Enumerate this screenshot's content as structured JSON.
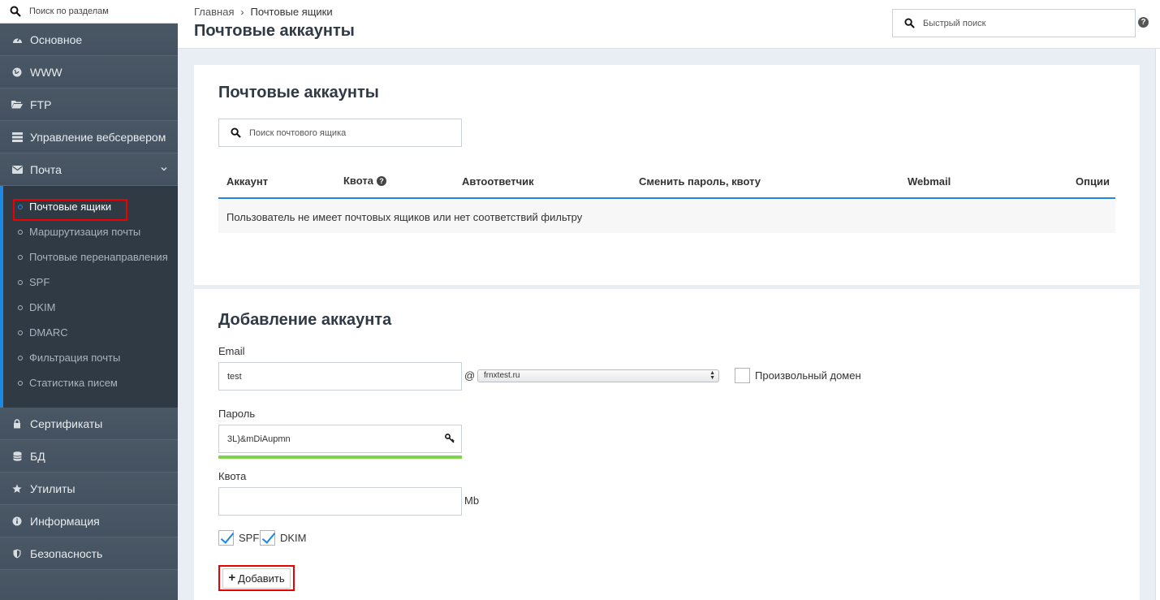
{
  "sidebar": {
    "search_placeholder": "Поиск по разделам",
    "items_top": [
      {
        "label": "Основное",
        "icon": "dashboard-icon"
      },
      {
        "label": "WWW",
        "icon": "globe-icon"
      },
      {
        "label": "FTP",
        "icon": "folder-icon"
      },
      {
        "label": "Управление вебсервером",
        "icon": "server-icon"
      },
      {
        "label": "Почта",
        "icon": "envelope-icon"
      }
    ],
    "mail_submenu": [
      "Почтовые ящики",
      "Маршрутизация почты",
      "Почтовые перенаправления",
      "SPF",
      "DKIM",
      "DMARC",
      "Фильтрация почты",
      "Статистика писем"
    ],
    "items_bottom": [
      {
        "label": "Сертификаты",
        "icon": "lock-icon"
      },
      {
        "label": "БД",
        "icon": "database-icon"
      },
      {
        "label": "Утилиты",
        "icon": "star-icon"
      },
      {
        "label": "Информация",
        "icon": "info-icon"
      },
      {
        "label": "Безопасность",
        "icon": "shield-icon"
      }
    ]
  },
  "header": {
    "breadcrumb_home": "Главная",
    "breadcrumb_current": "Почтовые ящики",
    "title": "Почтовые аккаунты",
    "quick_search_placeholder": "Быстрый поиск"
  },
  "accounts": {
    "title": "Почтовые аккаунты",
    "search_placeholder": "Поиск почтового ящика",
    "columns": {
      "account": "Аккаунт",
      "quota": "Квота",
      "autoresponder": "Автоответчик",
      "change": "Сменить пароль, квоту",
      "webmail": "Webmail",
      "options": "Опции"
    },
    "empty_text": "Пользователь не имеет почтовых ящиков или нет соответствий фильтру"
  },
  "add_form": {
    "title": "Добавление аккаунта",
    "email_label": "Email",
    "email_value": "test",
    "at_sign": "@",
    "domain_selected": "frnxtest.ru",
    "custom_domain_label": "Произвольный домен",
    "password_label": "Пароль",
    "password_value": "3L)&mDiAupmn",
    "password_strength": 1.0,
    "quota_label": "Квота",
    "quota_value": "",
    "quota_unit": "Mb",
    "spf_label": "SPF",
    "dkim_label": "DKIM",
    "add_button": "Добавить"
  },
  "colors": {
    "sidebar_bg": "#3c4a57",
    "accent": "#1e88e5",
    "highlight": "#ee0000",
    "strength_bar": "#7dd34a"
  }
}
